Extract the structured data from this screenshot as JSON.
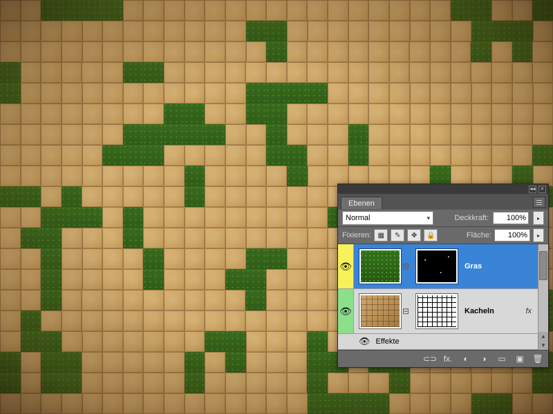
{
  "panel": {
    "title": "Ebenen",
    "blend_mode": "Normal",
    "opacity_label": "Deckkraft:",
    "opacity_value": "100%",
    "lock_label": "Fixieren:",
    "fill_label": "Fläche:",
    "fill_value": "100%"
  },
  "layers": [
    {
      "name": "Gras",
      "selected": true,
      "visibility_color": "yellow",
      "has_fx": false
    },
    {
      "name": "Kacheln",
      "selected": false,
      "visibility_color": "green",
      "has_fx": true
    }
  ],
  "effects_label": "Effekte",
  "fx_label": "fx",
  "icons": {
    "collapse": "◂◂",
    "close": "×",
    "caret_down": "▾",
    "stepper": "▸",
    "eye": "👁",
    "link": "⊟",
    "lock_transparent": "▦",
    "lock_paint": "✎",
    "lock_move": "✥",
    "lock_all": "🔒",
    "footer_link": "⊂⊃",
    "footer_fx": "fx.",
    "footer_mask": "◐",
    "footer_adjust": "◑",
    "footer_group": "▭",
    "footer_new": "▣",
    "footer_trash": "🗑",
    "scroll_up": "▲",
    "scroll_down": "▼"
  }
}
